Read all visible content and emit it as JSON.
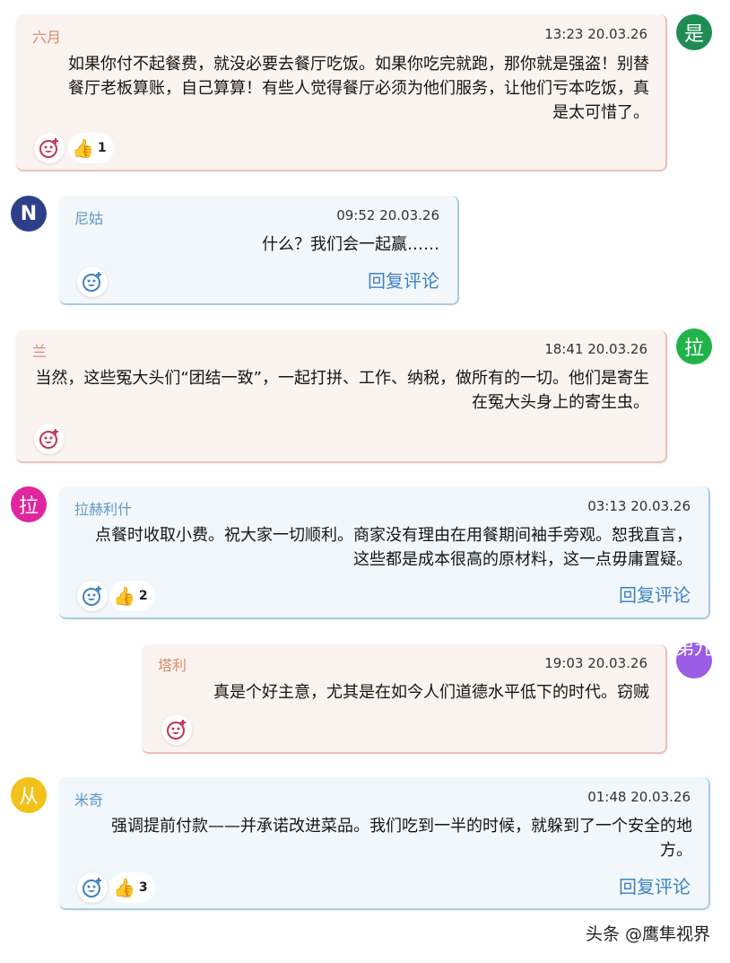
{
  "colors": {
    "warm_bg": "#fbf3ef",
    "cool_bg": "#f1f7fb",
    "warm_author": "#d98b6c",
    "cool_author": "#5f98c6",
    "reply_link": "#3f82c1"
  },
  "comments": [
    {
      "author": "六月",
      "time": "13:23 20.03.26",
      "text": "如果你付不起餐费，就没必要去餐厅吃饭。如果你吃完就跑，那你就是强盗！别替餐厅老板算账，自己算算！有些人觉得餐厅必须为他们服务，让他们亏本吃饭，真是太可惜了。",
      "likes": "1",
      "avatar_char": "是",
      "avatar_color": "#1f8c54"
    },
    {
      "author": "尼姑",
      "time": "09:52 20.03.26",
      "text": "什么？我们会一起赢……",
      "reply_label": "回复评论",
      "avatar_char": "N",
      "avatar_color": "#2e3f8a"
    },
    {
      "author": "兰",
      "time": "18:41 20.03.26",
      "text": "当然，这些冤大头们“团结一致”，一起打拼、工作、纳税，做所有的一切。他们是寄生在冤大头身上的寄生虫。",
      "avatar_char": "拉",
      "avatar_color": "#21b34a"
    },
    {
      "author": "拉赫利什",
      "time": "03:13 20.03.26",
      "text": "点餐时收取小费。祝大家一切顺利。商家没有理由在用餐期间袖手旁观。恕我直言，这些都是成本很高的原材料，这一点毋庸置疑。",
      "likes": "2",
      "reply_label": "回复评论",
      "avatar_char": "拉",
      "avatar_color": "#e0259e"
    },
    {
      "author": "塔利",
      "time": "19:03 20.03.26",
      "text": "真是个好主意，尤其是在如今人们道德水平低下的时代。窃贼",
      "avatar_char": "弟九",
      "avatar_color": "#9b5ce6"
    },
    {
      "author": "米奇",
      "time": "01:48 20.03.26",
      "text": "强调提前付款——并承诺改进菜品。我们吃到一半的时候，就躲到了一个安全的地方。",
      "likes": "3",
      "reply_label": "回复评论",
      "avatar_char": "从",
      "avatar_color": "#f2c21a"
    }
  ],
  "footer": "头条 @鹰隼视界"
}
